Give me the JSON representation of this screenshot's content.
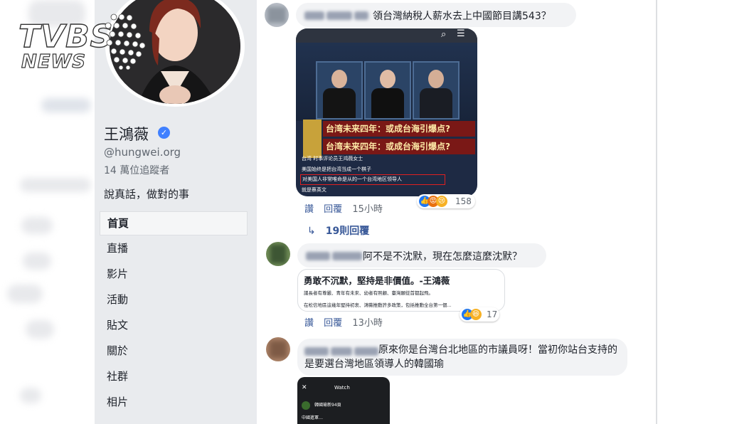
{
  "logo": {
    "line1": "TVBS",
    "line2": "NEWS"
  },
  "profile": {
    "name": "王鴻薇",
    "handle": "@hungwei.org",
    "followers": "14 萬位追蹤者",
    "bio": "說真話，做對的事"
  },
  "nav": [
    {
      "label": "首頁",
      "active": true
    },
    {
      "label": "直播"
    },
    {
      "label": "影片"
    },
    {
      "label": "活動"
    },
    {
      "label": "貼文"
    },
    {
      "label": "關於"
    },
    {
      "label": "社群"
    },
    {
      "label": "相片"
    }
  ],
  "comments": [
    {
      "text": "領台灣納稅人薪水去上中國節目講543？",
      "image": {
        "caption_line1": "台湾未来四年：或成台海引爆点?",
        "caption_line2": "台湾未来四年：或成台海引爆点?",
        "sub_line1": "台湾 时事评论员王鸿薇女士",
        "sub_line2": "美国始终是把台湾当成一个棋子",
        "sub_line3": "对美国人非常唯命是从的一个台湾地区领导人",
        "sub_line4": "就是蔡英文"
      },
      "like_label": "讚",
      "reply_label": "回覆",
      "time": "15小時",
      "reaction_count": "158",
      "replies_label": "19則回覆"
    },
    {
      "text": "阿不是不沈默，現在怎麼這麼沈默？",
      "quote": {
        "title": "勇敢不沉默，堅持是非價值。-王鴻薇",
        "line1": "議長者有尊嚴、青年有未來、幼者有照顧、臺灣願從首都起飛。",
        "line2": "在松信地區這幾年堅持初衷、鴻薇推動許多政策，包括推動全台第一個..."
      },
      "like_label": "讚",
      "reply_label": "回覆",
      "time": "13小時",
      "reaction_count": "17"
    },
    {
      "text": "原來你是台灣台北地區的市議員呀！當初你站台支持的是要選台灣地區領導人的韓國瑜",
      "image": {
        "header": "Watch",
        "line1": "韓國瑜新94頁",
        "line2": "中國進軍…"
      }
    }
  ],
  "colors": {
    "link": "#385898",
    "sidebar_bg": "#e9ebee",
    "bubble_bg": "#f2f3f5"
  }
}
